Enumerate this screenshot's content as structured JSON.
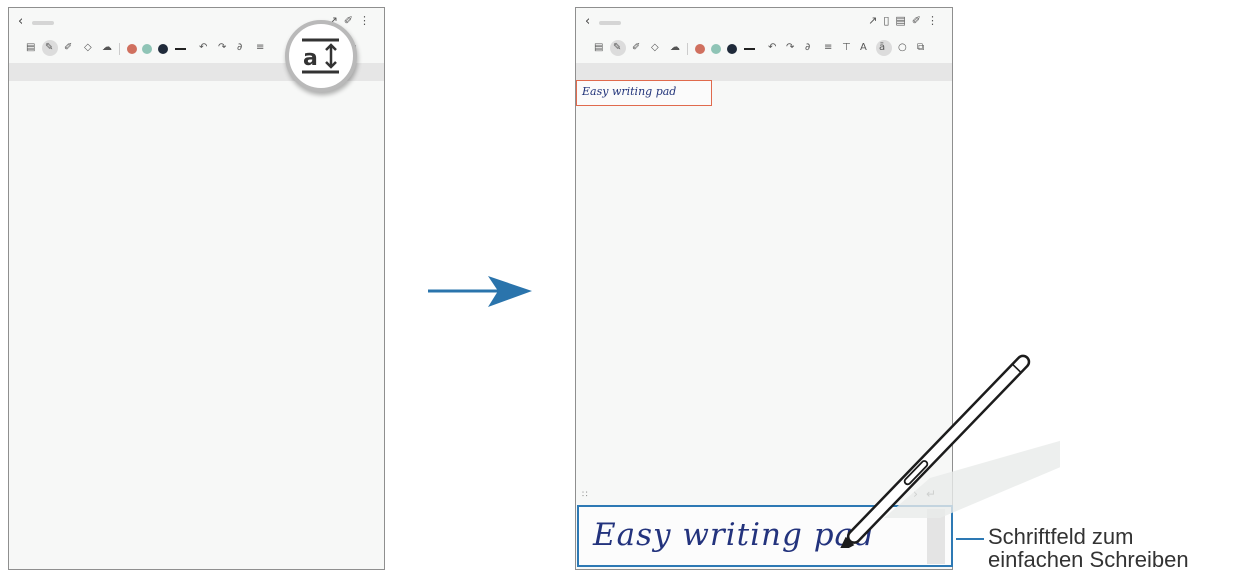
{
  "before": {
    "back_icon": "chevron-left-icon",
    "top_icons": [
      "expand-icon",
      "attach-icon",
      "more-icon"
    ],
    "magnifier_glyph": "a"
  },
  "after": {
    "back_icon": "chevron-left-icon",
    "top_icons": [
      "expand-icon",
      "book-icon",
      "layout-icon",
      "attach-icon",
      "more-icon"
    ],
    "colors": [
      "#d0705f",
      "#8fc4b6",
      "#1f2a3a"
    ],
    "text_box_content": "Easy writing pad"
  },
  "writing_pad": {
    "handwriting": "Easy writing pad"
  },
  "callout": {
    "line1": "Schriftfeld zum",
    "line2": "einfachen Schreiben"
  },
  "accent_color": "#2d79b4",
  "arrow_color": "#2a74ac"
}
